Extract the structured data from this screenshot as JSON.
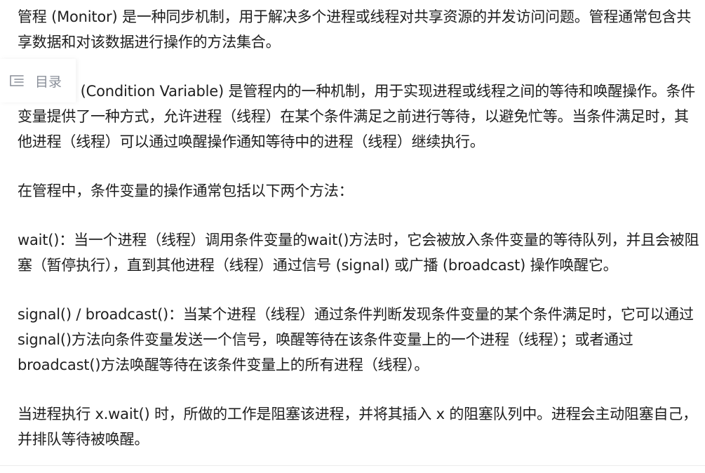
{
  "toc": {
    "label": "目录",
    "icon": "list-icon",
    "color": "#8a8f99"
  },
  "article": {
    "paragraphs": [
      "管程 (Monitor) 是一种同步机制，用于解决多个进程或线程对共享资源的并发访问问题。管程通常包含共享数据和对该数据进行操作的方法集合。",
      "条件变量 (Condition Variable) 是管程内的一种机制，用于实现进程或线程之间的等待和唤醒操作。条件变量提供了一种方式，允许进程（线程）在某个条件满足之前进行等待，以避免忙等。当条件满足时，其他进程（线程）可以通过唤醒操作通知等待中的进程（线程）继续执行。",
      "在管程中，条件变量的操作通常包括以下两个方法：",
      "wait()：当一个进程（线程）调用条件变量的wait()方法时，它会被放入条件变量的等待队列，并且会被阻塞（暂停执行），直到其他进程（线程）通过信号 (signal) 或广播 (broadcast) 操作唤醒它。",
      "signal() / broadcast()：当某个进程（线程）通过条件判断发现条件变量的某个条件满足时，它可以通过signal()方法向条件变量发送一个信号，唤醒等待在该条件变量上的一个进程（线程）；或者通过broadcast()方法唤醒等待在该条件变量上的所有进程（线程）。",
      "当进程执行 x.wait() 时，所做的工作是阻塞该进程，并将其插入 x 的阻塞队列中。进程会主动阻塞自己，并排队等待被唤醒。"
    ]
  }
}
